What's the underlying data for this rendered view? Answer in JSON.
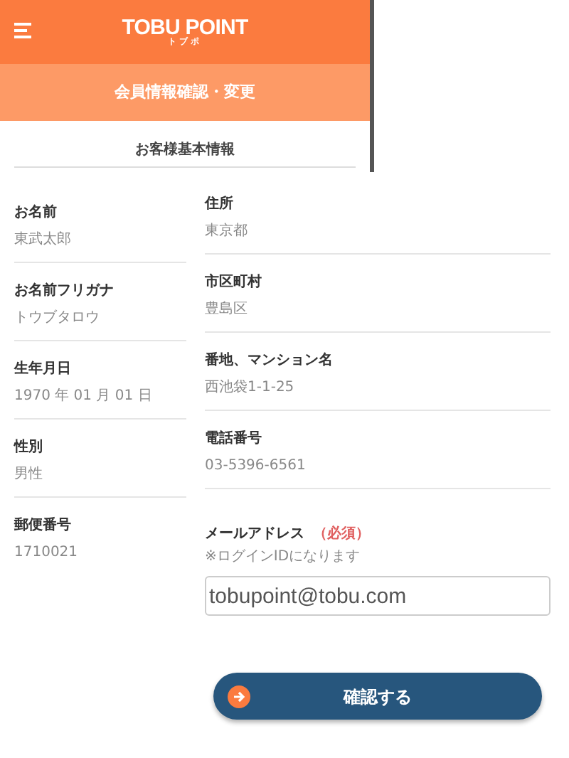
{
  "header": {
    "logo": "TOBU POINT",
    "logo_sub": "トブポ"
  },
  "page_title": "会員情報確認・変更",
  "section_title": "お客様基本情報",
  "left_fields": [
    {
      "label": "お名前",
      "value": "東武太郎"
    },
    {
      "label": "お名前フリガナ",
      "value": "トウブタロウ"
    },
    {
      "label": "生年月日",
      "value": "1970 年 01 月 01 日"
    },
    {
      "label": "性別",
      "value": "男性"
    },
    {
      "label": "郵便番号",
      "value": "1710021"
    }
  ],
  "right_fields": [
    {
      "label": "住所",
      "value": "東京都"
    },
    {
      "label": "市区町村",
      "value": "豊島区"
    },
    {
      "label": "番地、マンション名",
      "value": "西池袋1-1-25"
    },
    {
      "label": "電話番号",
      "value": "03-5396-6561"
    }
  ],
  "email": {
    "label": "メールアドレス",
    "required": "（必須）",
    "note": "※ログインIDになります",
    "value": "tobupoint@tobu.com"
  },
  "confirm_button": "確認する"
}
